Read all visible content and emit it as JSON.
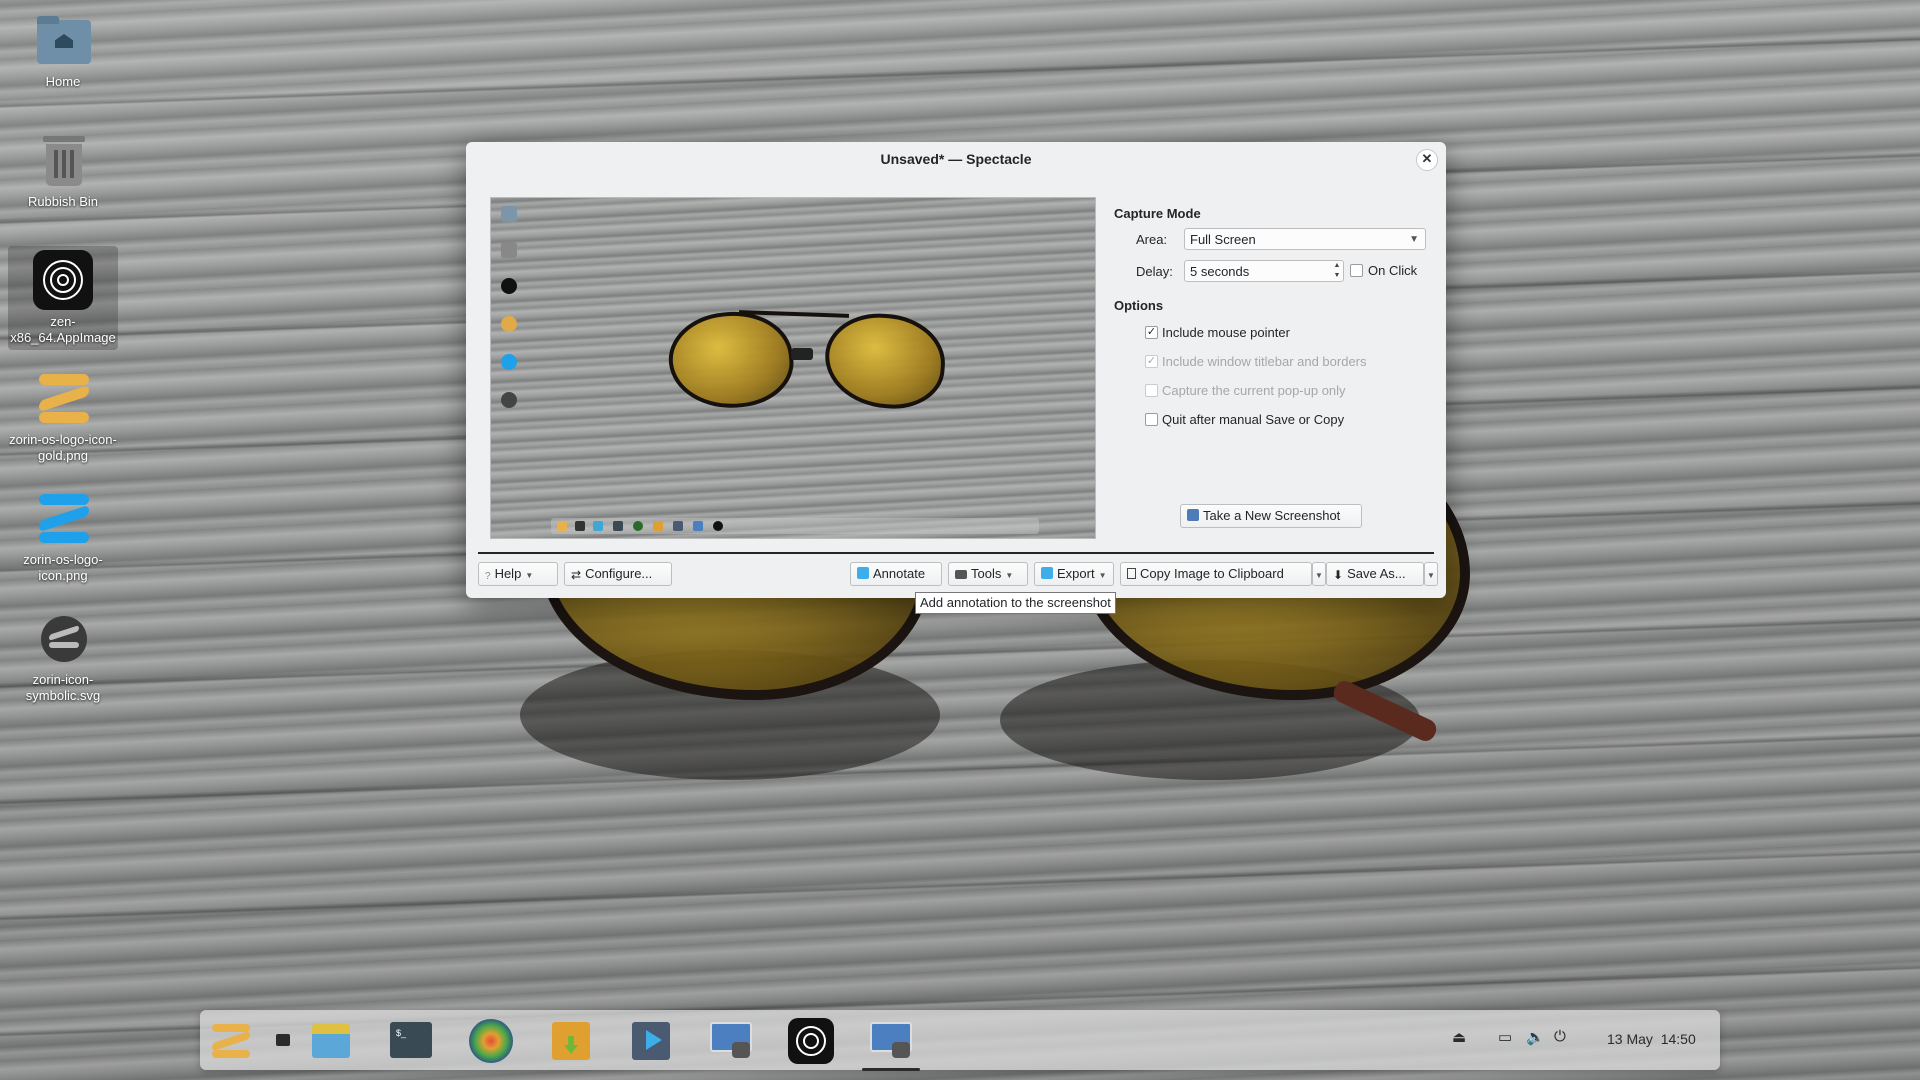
{
  "desktop": {
    "icons": [
      {
        "label": "Home",
        "icon": "home-folder-icon"
      },
      {
        "label": "Rubbish Bin",
        "icon": "trash-icon"
      },
      {
        "label": "zen-x86_64.AppImage",
        "icon": "zen-browser-icon"
      },
      {
        "label": "zorin-os-logo-icon-gold.png",
        "icon": "zorin-logo-gold-icon"
      },
      {
        "label": "zorin-os-logo-icon.png",
        "icon": "zorin-logo-blue-icon"
      },
      {
        "label": "zorin-icon-symbolic.svg",
        "icon": "zorin-symbolic-icon"
      }
    ]
  },
  "window": {
    "title": "Unsaved* — Spectacle",
    "capture_mode": {
      "heading": "Capture Mode",
      "area_label": "Area:",
      "area_value": "Full Screen",
      "delay_label": "Delay:",
      "delay_value": "5 seconds",
      "on_click_label": "On Click",
      "on_click_checked": false
    },
    "options": {
      "heading": "Options",
      "items": [
        {
          "label": "Include mouse pointer",
          "checked": true,
          "enabled": true
        },
        {
          "label": "Include window titlebar and borders",
          "checked": true,
          "enabled": false
        },
        {
          "label": "Capture the current pop-up only",
          "checked": false,
          "enabled": false
        },
        {
          "label": "Quit after manual Save or Copy",
          "checked": false,
          "enabled": true
        }
      ]
    },
    "take_screenshot_label": "Take a New Screenshot",
    "bottom_bar": {
      "help": "Help",
      "configure": "Configure...",
      "annotate": "Annotate",
      "tools": "Tools",
      "export": "Export",
      "copy": "Copy Image to Clipboard",
      "save_as": "Save As..."
    },
    "tooltip": "Add annotation to the screenshot"
  },
  "taskbar": {
    "clock": "13 May  14:50",
    "apps": [
      "zorin-menu-icon",
      "workspaces-icon",
      "files-icon",
      "terminal-icon",
      "browser-icon",
      "software-store-icon",
      "media-player-icon",
      "spectacle-icon",
      "zen-browser-icon",
      "spectacle-active-icon"
    ],
    "tray": [
      "eject-icon",
      "display-icon",
      "volume-icon",
      "power-icon"
    ]
  },
  "colors": {
    "accent": "#3daee9",
    "window_bg": "#eff0f1",
    "lens_yellow": "#d2aa28"
  }
}
